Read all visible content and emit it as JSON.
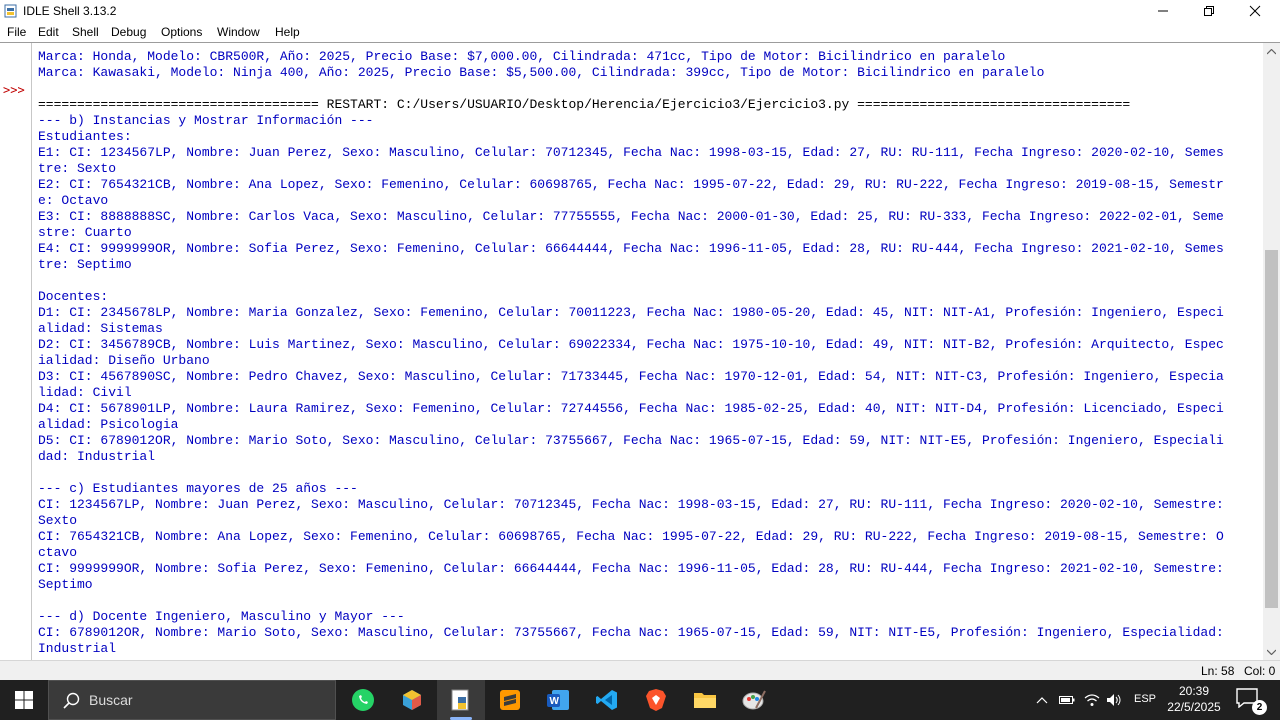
{
  "window": {
    "title": "IDLE Shell 3.13.2",
    "minimize_glyph": "—",
    "maximize_glyph": "❐",
    "close_glyph": "✕"
  },
  "menu": [
    "File",
    "Edit",
    "Shell",
    "Debug",
    "Options",
    "Window",
    "Help"
  ],
  "shell": {
    "prompt": ">>>",
    "lines": [
      "Marca: Honda, Modelo: CBR500R, Año: 2025, Precio Base: $7,000.00, Cilindrada: 471cc, Tipo de Motor: Bicilindrico en paralelo",
      "Marca: Kawasaki, Modelo: Ninja 400, Año: 2025, Precio Base: $5,500.00, Cilindrada: 399cc, Tipo de Motor: Bicilindrico en paralelo",
      "",
      "==================================== RESTART: C:/Users/USUARIO/Desktop/Herencia/Ejercicio3/Ejercicio3.py ===================================",
      "--- b) Instancias y Mostrar Información ---",
      "Estudiantes:",
      "E1: CI: 1234567LP, Nombre: Juan Perez, Sexo: Masculino, Celular: 70712345, Fecha Nac: 1998-03-15, Edad: 27, RU: RU-111, Fecha Ingreso: 2020-02-10, Semes",
      "tre: Sexto",
      "E2: CI: 7654321CB, Nombre: Ana Lopez, Sexo: Femenino, Celular: 60698765, Fecha Nac: 1995-07-22, Edad: 29, RU: RU-222, Fecha Ingreso: 2019-08-15, Semestr",
      "e: Octavo",
      "E3: CI: 8888888SC, Nombre: Carlos Vaca, Sexo: Masculino, Celular: 77755555, Fecha Nac: 2000-01-30, Edad: 25, RU: RU-333, Fecha Ingreso: 2022-02-01, Seme",
      "stre: Cuarto",
      "E4: CI: 9999999OR, Nombre: Sofia Perez, Sexo: Femenino, Celular: 66644444, Fecha Nac: 1996-11-05, Edad: 28, RU: RU-444, Fecha Ingreso: 2021-02-10, Semes",
      "tre: Septimo",
      "",
      "Docentes:",
      "D1: CI: 2345678LP, Nombre: Maria Gonzalez, Sexo: Femenino, Celular: 70011223, Fecha Nac: 1980-05-20, Edad: 45, NIT: NIT-A1, Profesión: Ingeniero, Especi",
      "alidad: Sistemas",
      "D2: CI: 3456789CB, Nombre: Luis Martinez, Sexo: Masculino, Celular: 69022334, Fecha Nac: 1975-10-10, Edad: 49, NIT: NIT-B2, Profesión: Arquitecto, Espec",
      "ialidad: Diseño Urbano",
      "D3: CI: 4567890SC, Nombre: Pedro Chavez, Sexo: Masculino, Celular: 71733445, Fecha Nac: 1970-12-01, Edad: 54, NIT: NIT-C3, Profesión: Ingeniero, Especia",
      "lidad: Civil",
      "D4: CI: 5678901LP, Nombre: Laura Ramirez, Sexo: Femenino, Celular: 72744556, Fecha Nac: 1985-02-25, Edad: 40, NIT: NIT-D4, Profesión: Licenciado, Especi",
      "alidad: Psicologia",
      "D5: CI: 6789012OR, Nombre: Mario Soto, Sexo: Masculino, Celular: 73755667, Fecha Nac: 1965-07-15, Edad: 59, NIT: NIT-E5, Profesión: Ingeniero, Especiali",
      "dad: Industrial",
      "",
      "--- c) Estudiantes mayores de 25 años ---",
      "CI: 1234567LP, Nombre: Juan Perez, Sexo: Masculino, Celular: 70712345, Fecha Nac: 1998-03-15, Edad: 27, RU: RU-111, Fecha Ingreso: 2020-02-10, Semestre:",
      "Sexto",
      "CI: 7654321CB, Nombre: Ana Lopez, Sexo: Femenino, Celular: 60698765, Fecha Nac: 1995-07-22, Edad: 29, RU: RU-222, Fecha Ingreso: 2019-08-15, Semestre: O",
      "ctavo",
      "CI: 9999999OR, Nombre: Sofia Perez, Sexo: Femenino, Celular: 66644444, Fecha Nac: 1996-11-05, Edad: 28, RU: RU-444, Fecha Ingreso: 2021-02-10, Semestre:",
      "Septimo",
      "",
      "--- d) Docente Ingeniero, Masculino y Mayor ---",
      "CI: 6789012OR, Nombre: Mario Soto, Sexo: Masculino, Celular: 73755667, Fecha Nac: 1965-07-15, Edad: 59, NIT: NIT-E5, Profesión: Ingeniero, Especialidad:",
      "Industrial"
    ]
  },
  "status": {
    "ln": "Ln: 58",
    "col": "Col: 0"
  },
  "taskbar": {
    "search_placeholder": "Buscar",
    "apps": [
      "whatsapp-icon",
      "3d-box-app-icon",
      "idle-python-icon",
      "sublime-text-icon",
      "word-icon",
      "vscode-icon",
      "brave-icon",
      "file-explorer-icon",
      "paint-app-icon"
    ],
    "language": "ESP",
    "time": "20:39",
    "date": "22/5/2025",
    "notification_count": "2"
  },
  "colors": {
    "shell_output": "#0000c0",
    "restart_line": "#000000",
    "prompt": "#c00000",
    "taskbar": "#202020"
  }
}
